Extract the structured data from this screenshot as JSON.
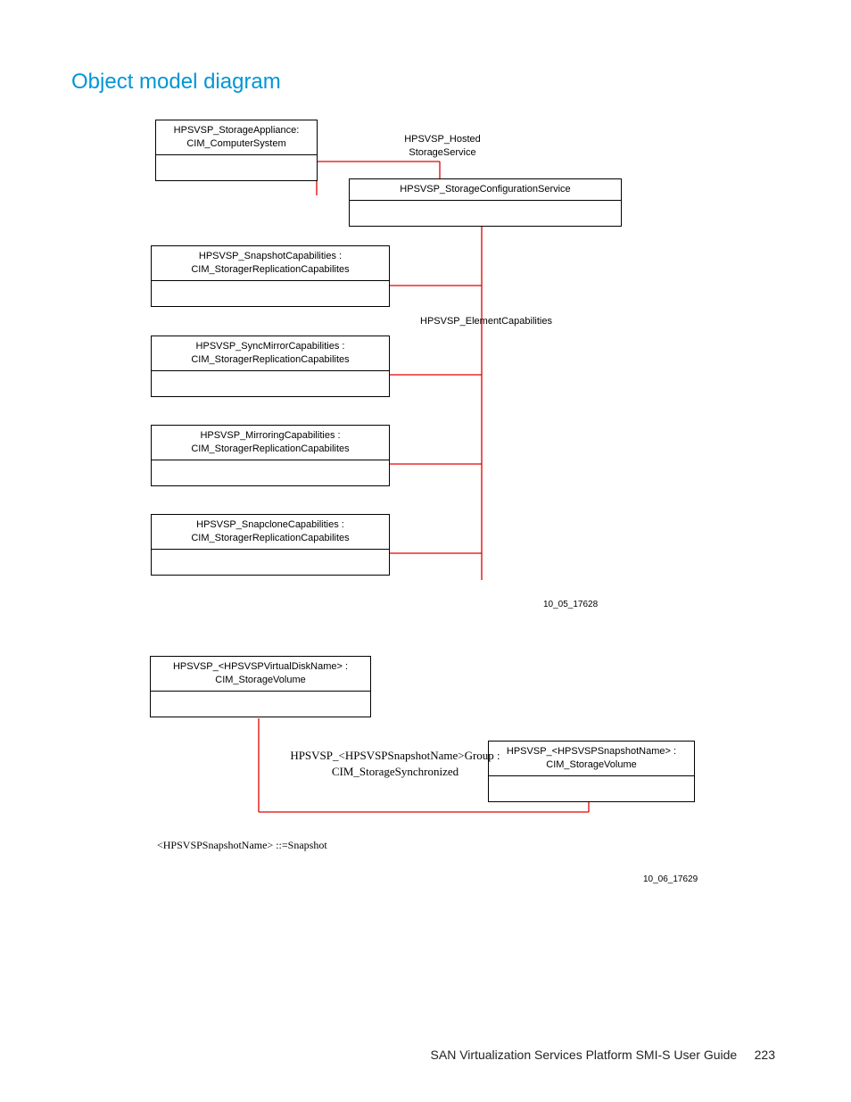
{
  "page_title": "Object model diagram",
  "boxes": {
    "appliance": "HPSVSP_StorageAppliance:\nCIM_ComputerSystem",
    "config_service": "HPSVSP_StorageConfigurationService",
    "snapshot_caps": "HPSVSP_SnapshotCapabilities :\nCIM_StoragerReplicationCapabilites",
    "syncmirror_caps": "HPSVSP_SyncMirrorCapabilities :\nCIM_StoragerReplicationCapabilites",
    "mirroring_caps": "HPSVSP_MirroringCapabilities :\nCIM_StoragerReplicationCapabilites",
    "snapclone_caps": "HPSVSP_SnapcloneCapabilities :\nCIM_StoragerReplicationCapabilites",
    "virtual_disk": "HPSVSP_<HPSVSPVirtualDiskName> :\nCIM_StorageVolume",
    "snapshot_vol": "HPSVSP_<HPSVSPSnapshotName> :\nCIM_StorageVolume"
  },
  "labels": {
    "hosted_service": "HPSVSP_Hosted\nStorageService",
    "element_caps": "HPSVSP_ElementCapabilities",
    "snapshot_group": "HPSVSP_<HPSVSPSnapshotName>Group :\nCIM_StorageSynchronized"
  },
  "note": "<HPSVSPSnapshotName> ::=Snapshot",
  "fig_id_1": "10_05_17628",
  "fig_id_2": "10_06_17629",
  "footer_title": "SAN Virtualization Services Platform SMI-S User Guide",
  "footer_page": "223"
}
